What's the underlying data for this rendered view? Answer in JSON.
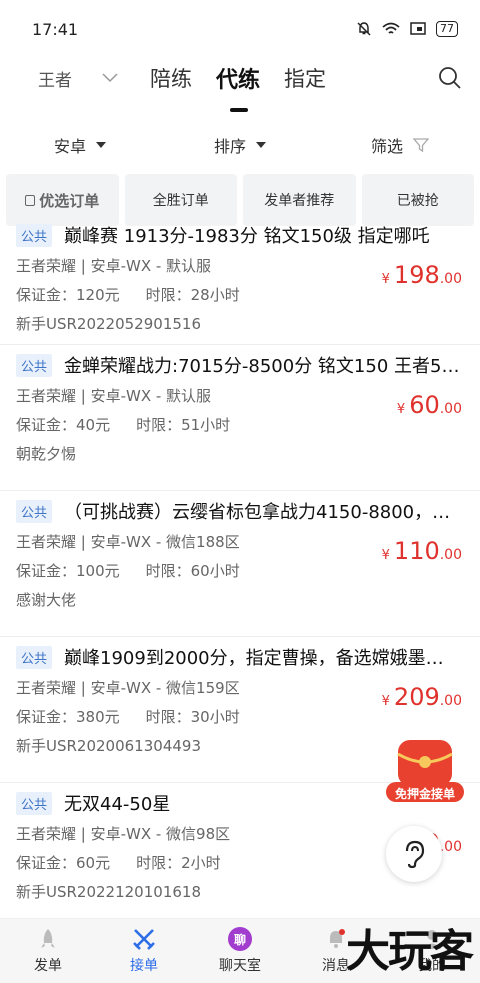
{
  "status": {
    "time": "17:41",
    "battery": "77"
  },
  "nav": {
    "game": "王者",
    "tabs": [
      "陪练",
      "代练",
      "指定"
    ]
  },
  "filters": {
    "platform": "安卓",
    "sort": "排序",
    "filter": "筛选"
  },
  "chips": [
    "优选订单",
    "全胜订单",
    "发单者推荐",
    "已被抢"
  ],
  "orders": [
    {
      "badge": "公共",
      "title": "巅峰赛 1913分-1983分 铭文150级 指定哪吒",
      "game": "王者荣耀 | 安卓-WX - 默认服",
      "deposit": "保证金：120元",
      "limit": "时限：28小时",
      "publisher": "新手USR2022052901516",
      "price_int": "198",
      "price_dec": ".00"
    },
    {
      "badge": "公共",
      "title": "金蝉荣耀战力:7015分-8500分 铭文150 王者5…",
      "game": "王者荣耀 | 安卓-WX - 默认服",
      "deposit": "保证金：40元",
      "limit": "时限：51小时",
      "publisher": "朝乾夕惕",
      "price_int": "60",
      "price_dec": ".00"
    },
    {
      "badge": "公共",
      "title": "（可挑战赛）云缨省标包拿战力4150-8800，…",
      "game": "王者荣耀 | 安卓-WX - 微信188区",
      "deposit": "保证金：100元",
      "limit": "时限：60小时",
      "publisher": "感谢大佬",
      "price_int": "110",
      "price_dec": ".00"
    },
    {
      "badge": "公共",
      "title": "巅峰1909到2000分，指定曹操，备选嫦娥墨…",
      "game": "王者荣耀 | 安卓-WX - 微信159区",
      "deposit": "保证金：380元",
      "limit": "时限：30小时",
      "publisher": "新手USR2020061304493",
      "price_int": "209",
      "price_dec": ".00"
    },
    {
      "badge": "公共",
      "title": "无双44-50星",
      "game": "王者荣耀 | 安卓-WX - 微信98区",
      "deposit": "保证金：60元",
      "limit": "时限：2小时",
      "publisher": "新手USR2022120101618",
      "price_int": "0",
      "price_dec": ".00"
    }
  ],
  "promo": {
    "label": "免押金接单"
  },
  "bottom": [
    "发单",
    "接单",
    "聊天室",
    "消息",
    "我的"
  ],
  "chat_icon_text": "聊",
  "watermark": "大玩客",
  "colors": {
    "accent": "#2e6de8",
    "price": "#e0322d",
    "badge": "#3e74c8"
  }
}
